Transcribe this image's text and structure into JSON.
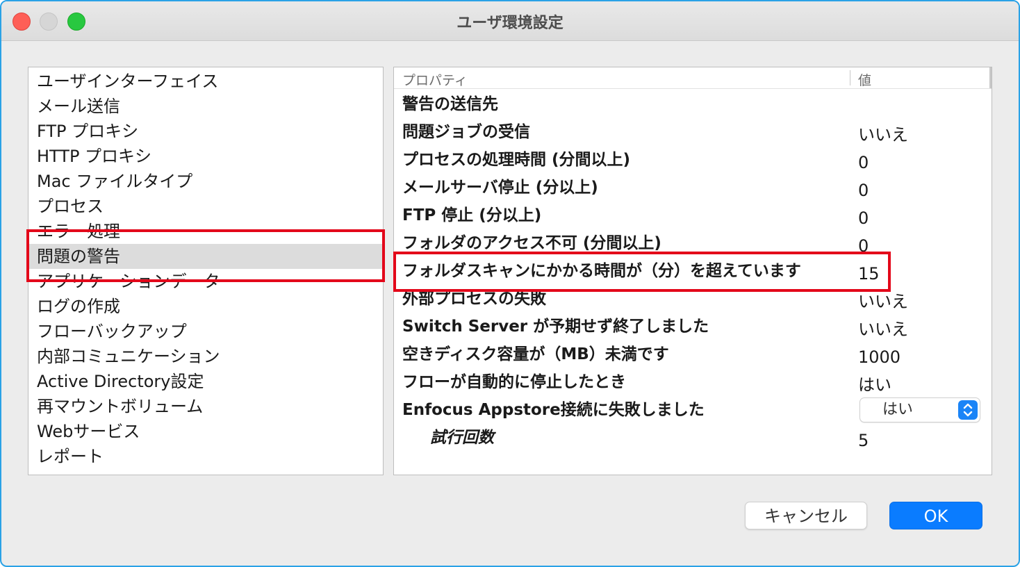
{
  "window": {
    "title": "ユーザ環境設定"
  },
  "categories": [
    {
      "label": "ユーザインターフェイス"
    },
    {
      "label": "メール送信"
    },
    {
      "label": "FTP プロキシ"
    },
    {
      "label": "HTTP プロキシ"
    },
    {
      "label": "Mac ファイルタイプ"
    },
    {
      "label": "プロセス"
    },
    {
      "label": "エラー処理"
    },
    {
      "label": "問題の警告"
    },
    {
      "label": "アプリケーションデータ"
    },
    {
      "label": "ログの作成"
    },
    {
      "label": "フローバックアップ"
    },
    {
      "label": "内部コミュニケーション"
    },
    {
      "label": "Active Directory設定"
    },
    {
      "label": "再マウントボリューム"
    },
    {
      "label": "Webサービス"
    },
    {
      "label": "レポート"
    }
  ],
  "selected_category": "問題の警告",
  "table": {
    "header_property": "プロパティ",
    "header_value": "値",
    "rows": [
      {
        "name": "警告の送信先",
        "value": ""
      },
      {
        "name": "問題ジョブの受信",
        "value": "いいえ"
      },
      {
        "name": "プロセスの処理時間 (分間以上)",
        "value": "0"
      },
      {
        "name": "メールサーバ停止 (分以上)",
        "value": "0"
      },
      {
        "name": "FTP 停止 (分以上)",
        "value": "0"
      },
      {
        "name": "フォルダのアクセス不可 (分間以上)",
        "value": "0"
      },
      {
        "name": "フォルダスキャンにかかる時間が（分）を超えています",
        "value": "15"
      },
      {
        "name": "外部プロセスの失敗",
        "value": "いいえ"
      },
      {
        "name": "Switch Server が予期せず終了しました",
        "value": "いいえ"
      },
      {
        "name": "空きディスク容量が（MB）未満です",
        "value": "1000"
      },
      {
        "name": "フローが自動的に停止したとき",
        "value": "はい"
      },
      {
        "name": "Enfocus Appstore接続に失敗しました",
        "value": "はい"
      },
      {
        "name": "試行回数",
        "value": "5"
      }
    ]
  },
  "buttons": {
    "cancel": "キャンセル",
    "ok": "OK"
  },
  "colors": {
    "accent": "#0a7cff",
    "highlight": "#e3071a",
    "selection": "#dcdcdc"
  }
}
